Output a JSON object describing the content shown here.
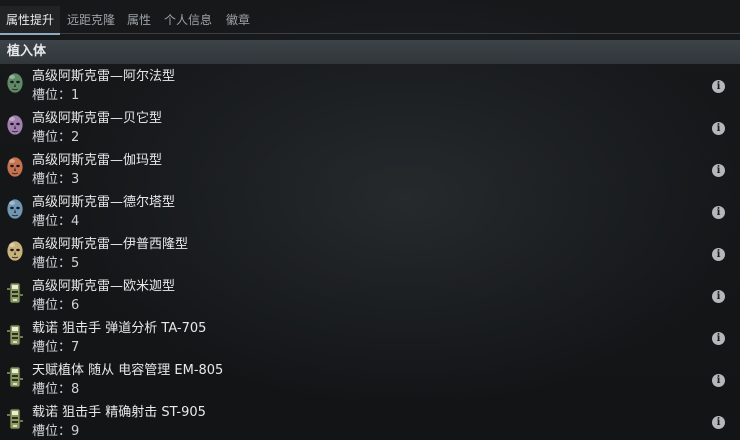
{
  "tabs": [
    {
      "label": "属性提升",
      "active": true
    },
    {
      "label": "远距克隆",
      "active": false
    },
    {
      "label": "属性",
      "active": false
    },
    {
      "label": "个人信息",
      "active": false
    },
    {
      "label": "徽章",
      "active": false
    }
  ],
  "section": {
    "title": "植入体"
  },
  "slot_prefix": "槽位：",
  "implants": [
    {
      "name": "高级阿斯克雷—阿尔法型",
      "slot": "1",
      "icon": "green-head-icon",
      "color": "#5f8a66"
    },
    {
      "name": "高级阿斯克雷—贝它型",
      "slot": "2",
      "icon": "purple-head-icon",
      "color": "#a27fb0"
    },
    {
      "name": "高级阿斯克雷—伽玛型",
      "slot": "3",
      "icon": "orange-head-icon",
      "color": "#c7724e"
    },
    {
      "name": "高级阿斯克雷—德尔塔型",
      "slot": "4",
      "icon": "blue-head-icon",
      "color": "#6f98b6"
    },
    {
      "name": "高级阿斯克雷—伊普西隆型",
      "slot": "5",
      "icon": "yellow-head-icon",
      "color": "#c9b17a"
    },
    {
      "name": "高级阿斯克雷—欧米迦型",
      "slot": "6",
      "icon": "implant-chip-icon",
      "color": "#8a9a62"
    },
    {
      "name": "载诺 狙击手 弹道分析 TA-705",
      "slot": "7",
      "icon": "implant-chip-icon",
      "color": "#8a9a62"
    },
    {
      "name": "天赋植体 随从 电容管理 EM-805",
      "slot": "8",
      "icon": "implant-chip-icon",
      "color": "#8a9a62"
    },
    {
      "name": "载诺 狙击手 精确射击 ST-905",
      "slot": "9",
      "icon": "implant-chip-icon",
      "color": "#8a9a62"
    }
  ],
  "info_glyph": "i"
}
